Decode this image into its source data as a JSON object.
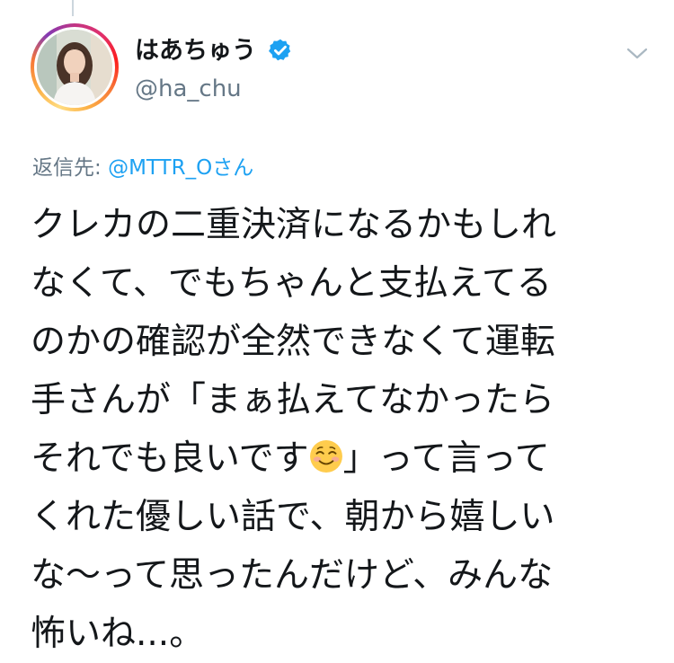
{
  "tweet": {
    "author": {
      "display_name": "はあちゅう",
      "handle": "@ha_chu",
      "verified": true,
      "avatar_icon": "profile-photo"
    },
    "menu_icon": "chevron-down-icon",
    "reply_to": {
      "prefix": "返信先: ",
      "mention": "@MTTR_O",
      "suffix": "さん"
    },
    "text_lines": [
      "クレカの二重決済になるかもしれ",
      "なくて、でもちゃんと支払えてる",
      "のかの確認が全然できなくて運転",
      "手さんが「まぁ払えてなかったら",
      "それでも良いです",
      "」って言って",
      "くれた優しい話で、朝から嬉しい",
      "な〜って思ったんだけど、みんな",
      "怖いね...。"
    ],
    "emoji": "smiling-face-icon"
  },
  "colors": {
    "text": "#14171a",
    "secondary": "#657786",
    "link": "#1da1f2",
    "verified": "#1da1f2",
    "divider": "#ccd6dd"
  }
}
